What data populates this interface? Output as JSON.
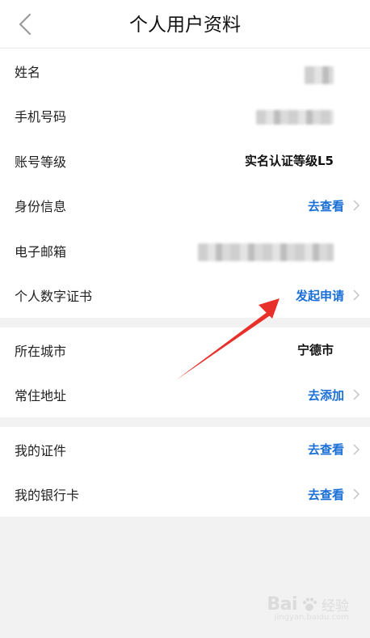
{
  "header": {
    "title": "个人用户资料",
    "back_icon": "chevron-left-icon"
  },
  "profile": {
    "name_label": "姓名",
    "phone_label": "手机号码",
    "level_label": "账号等级",
    "level_value": "实名认证等级L5",
    "identity_label": "身份信息",
    "identity_action": "去查看",
    "email_label": "电子邮箱",
    "cert_label": "个人数字证书",
    "cert_action": "发起申请"
  },
  "address": {
    "city_label": "所在城市",
    "city_value": "宁德市",
    "residence_label": "常住地址",
    "residence_action": "去添加"
  },
  "documents": {
    "certificates_label": "我的证件",
    "certificates_action": "去查看",
    "bankcards_label": "我的银行卡",
    "bankcards_action": "去查看"
  },
  "watermark": {
    "brand": "Bai",
    "brand_suffix": "经验",
    "url": "jingyan.baidu.com"
  },
  "colors": {
    "link": "#1a6fd6",
    "annotation_arrow": "#e8302a",
    "background": "#f2f2f2"
  }
}
